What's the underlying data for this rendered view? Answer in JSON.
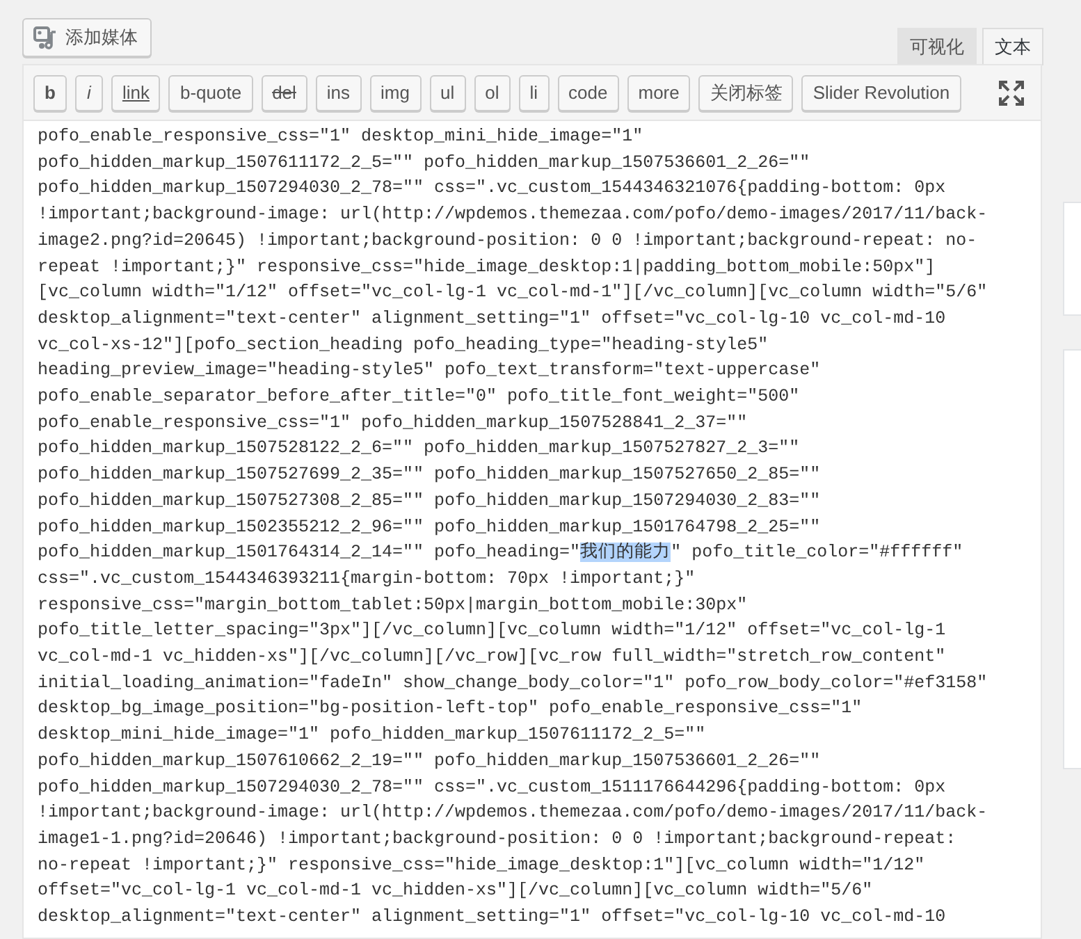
{
  "media_button": {
    "label": "添加媒体"
  },
  "editor_tabs": [
    {
      "label": "可视化",
      "selected": false
    },
    {
      "label": "文本",
      "selected": true
    }
  ],
  "quicktags": [
    {
      "label": "b",
      "kind": "bold"
    },
    {
      "label": "i",
      "kind": "italic"
    },
    {
      "label": "link",
      "kind": "underline"
    },
    {
      "label": "b-quote",
      "kind": "plain"
    },
    {
      "label": "del",
      "kind": "strike"
    },
    {
      "label": "ins",
      "kind": "plain"
    },
    {
      "label": "img",
      "kind": "plain"
    },
    {
      "label": "ul",
      "kind": "plain"
    },
    {
      "label": "ol",
      "kind": "plain"
    },
    {
      "label": "li",
      "kind": "plain"
    },
    {
      "label": "code",
      "kind": "plain"
    },
    {
      "label": "more",
      "kind": "plain"
    },
    {
      "label": "关闭标签",
      "kind": "plain"
    },
    {
      "label": "Slider Revolution",
      "kind": "plain"
    }
  ],
  "content_lines": [
    "pofo_enable_responsive_css=\"1\" desktop_mini_hide_image=\"1\"",
    "pofo_hidden_markup_1507611172_2_5=\"\" pofo_hidden_markup_1507536601_2_26=\"\"",
    "pofo_hidden_markup_1507294030_2_78=\"\" css=\".vc_custom_1544346321076{padding-bottom: 0px",
    "!important;background-image: url(http://wpdemos.themezaa.com/pofo/demo-images/2017/11/back-",
    "image2.png?id=20645) !important;background-position: 0 0 !important;background-repeat: no-",
    "repeat !important;}\" responsive_css=\"hide_image_desktop:1|padding_bottom_mobile:50px\"]",
    "[vc_column width=\"1/12\" offset=\"vc_col-lg-1 vc_col-md-1\"][/vc_column][vc_column width=\"5/6\"",
    "desktop_alignment=\"text-center\" alignment_setting=\"1\" offset=\"vc_col-lg-10 vc_col-md-10",
    "vc_col-xs-12\"][pofo_section_heading pofo_heading_type=\"heading-style5\"",
    "heading_preview_image=\"heading-style5\" pofo_text_transform=\"text-uppercase\"",
    "pofo_enable_separator_before_after_title=\"0\" pofo_title_font_weight=\"500\"",
    "pofo_enable_responsive_css=\"1\" pofo_hidden_markup_1507528841_2_37=\"\"",
    "pofo_hidden_markup_1507528122_2_6=\"\" pofo_hidden_markup_1507527827_2_3=\"\"",
    "pofo_hidden_markup_1507527699_2_35=\"\" pofo_hidden_markup_1507527650_2_85=\"\"",
    "pofo_hidden_markup_1507527308_2_85=\"\" pofo_hidden_markup_1507294030_2_83=\"\"",
    "pofo_hidden_markup_1502355212_2_96=\"\" pofo_hidden_markup_1501764798_2_25=\"\"",
    {
      "parts": [
        {
          "text": "pofo_hidden_markup_1501764314_2_14=\"\" pofo_heading=\"",
          "highlighted": false
        },
        {
          "text": "我们的能力",
          "highlighted": true
        },
        {
          "text": "\" pofo_title_color=\"#ffffff\"",
          "highlighted": false
        }
      ]
    },
    "css=\".vc_custom_1544346393211{margin-bottom: 70px !important;}\"",
    "responsive_css=\"margin_bottom_tablet:50px|margin_bottom_mobile:30px\"",
    "pofo_title_letter_spacing=\"3px\"][/vc_column][vc_column width=\"1/12\" offset=\"vc_col-lg-1",
    "vc_col-md-1 vc_hidden-xs\"][/vc_column][/vc_row][vc_row full_width=\"stretch_row_content\"",
    "initial_loading_animation=\"fadeIn\" show_change_body_color=\"1\" pofo_row_body_color=\"#ef3158\"",
    "desktop_bg_image_position=\"bg-position-left-top\" pofo_enable_responsive_css=\"1\"",
    "desktop_mini_hide_image=\"1\" pofo_hidden_markup_1507611172_2_5=\"\"",
    "pofo_hidden_markup_1507610662_2_19=\"\" pofo_hidden_markup_1507536601_2_26=\"\"",
    "pofo_hidden_markup_1507294030_2_78=\"\" css=\".vc_custom_1511176644296{padding-bottom: 0px",
    "!important;background-image: url(http://wpdemos.themezaa.com/pofo/demo-images/2017/11/back-",
    "image1-1.png?id=20646) !important;background-position: 0 0 !important;background-repeat:",
    "no-repeat !important;}\" responsive_css=\"hide_image_desktop:1\"][vc_column width=\"1/12\"",
    "offset=\"vc_col-lg-1 vc_col-md-1 vc_hidden-xs\"][/vc_column][vc_column width=\"5/6\"",
    "desktop_alignment=\"text-center\" alignment_setting=\"1\" offset=\"vc_col-lg-10 vc_col-md-10"
  ]
}
